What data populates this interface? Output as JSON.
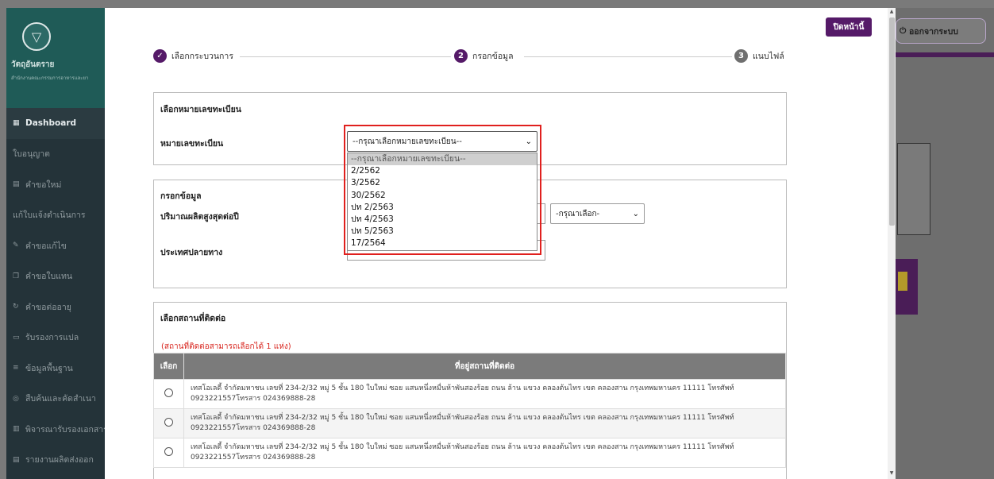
{
  "sidebar": {
    "brand_title": "วัตถุอันตราย",
    "brand_subtitle": "สำนักงานคณะกรรมการอาหารและยา",
    "items": [
      {
        "label": "Dashboard",
        "icon": "grid-icon",
        "active": true
      },
      {
        "label": "ใบอนุญาต",
        "icon": "",
        "active": false
      },
      {
        "label": "คำขอใหม่",
        "icon": "document-icon",
        "active": false
      },
      {
        "label": "แก้ใบแจ้งดำเนินการ",
        "icon": "",
        "active": false
      },
      {
        "label": "คำขอแก้ไข",
        "icon": "edit-icon",
        "active": false
      },
      {
        "label": "คำขอใบแทน",
        "icon": "copy-icon",
        "active": false
      },
      {
        "label": "คำขอต่ออายุ",
        "icon": "renew-icon",
        "active": false
      },
      {
        "label": "รับรองการแปล",
        "icon": "translate-icon",
        "active": false
      },
      {
        "label": "ข้อมูลพื้นฐาน",
        "icon": "list-icon",
        "active": false
      },
      {
        "label": "สืบค้นและคัดสำเนา",
        "icon": "search-copy-icon",
        "active": false
      },
      {
        "label": "พิจารณารับรองเอกสาร",
        "icon": "book-icon",
        "active": false
      },
      {
        "label": "รายงานผลิตส่งออก",
        "icon": "report-icon",
        "active": false
      }
    ]
  },
  "header": {
    "logout_label": "ออกจากระบบ",
    "close_label": "ปิดหน้านี้"
  },
  "stepper": {
    "steps": [
      {
        "num": "✓",
        "label": "เลือกกระบวนการ",
        "color": "#551a68"
      },
      {
        "num": "2",
        "label": "กรอกข้อมูล",
        "color": "#551a68"
      },
      {
        "num": "3",
        "label": "แนบไฟล์",
        "color": "#6f6f6f"
      }
    ]
  },
  "registration_panel": {
    "title": "เลือกหมายเลขทะเบียน",
    "field_label": "หมายเลขทะเบียน",
    "select_value": "--กรุณาเลือกหมายเลขทะเบียน--",
    "options": [
      "--กรุณาเลือกหมายเลขทะเบียน--",
      "2/2562",
      "3/2562",
      "30/2562",
      "ปท 2/2563",
      "ปท 4/2563",
      "ปท 5/2563",
      "17/2564"
    ]
  },
  "data_panel": {
    "title": "กรอกข้อมูล",
    "max_quantity_label": "ปริมาณผลิตสูงสุดต่อปี",
    "unit_select_value": "-กรุณาเลือก-",
    "destination_label": "ประเทศปลายทาง"
  },
  "contact_panel": {
    "title": "เลือกสถานที่ติดต่อ",
    "note": "(สถานที่ติดต่อสามารถเลือกได้ 1 แห่ง)",
    "col_select": "เลือก",
    "col_address": "ที่อยู่สถานที่ติดต่อ",
    "rows": [
      {
        "line1": "เทสโอเลดี้ จำกัดมหาชน เลขที่ 234-2/32 หมู่ 5 ชั้น 180 ใบใหม่ ซอย แสนหนึ่งหมื่นห้าพันสองร้อย ถนน ล้าน แขวง คลองต้นไทร เขต คลองสาน กรุงเทพมหานคร 11111 โทรศัพท์",
        "line2": "0923221557โทรสาร 024369888-28"
      },
      {
        "line1": "เทสโอเลดี้ จำกัดมหาชน เลขที่ 234-2/32 หมู่ 5 ชั้น 180 ใบใหม่ ซอย แสนหนึ่งหมื่นห้าพันสองร้อย ถนน ล้าน แขวง คลองต้นไทร เขต คลองสาน กรุงเทพมหานคร 11111 โทรศัพท์",
        "line2": "0923221557โทรสาร 024369888-28"
      },
      {
        "line1": "เทสโอเลดี้ จำกัดมหาชน เลขที่ 234-2/32 หมู่ 5 ชั้น 180 ใบใหม่ ซอย แสนหนึ่งหมื่นห้าพันสองร้อย ถนน ล้าน แขวง คลองต้นไทร เขต คลองสาน กรุงเทพมหานคร 11111 โทรศัพท์",
        "line2": "0923221557โทรสาร 024369888-28"
      }
    ]
  },
  "colors": {
    "accent": "#551a68",
    "highlight": "#e0201e",
    "note": "#d8261f"
  }
}
